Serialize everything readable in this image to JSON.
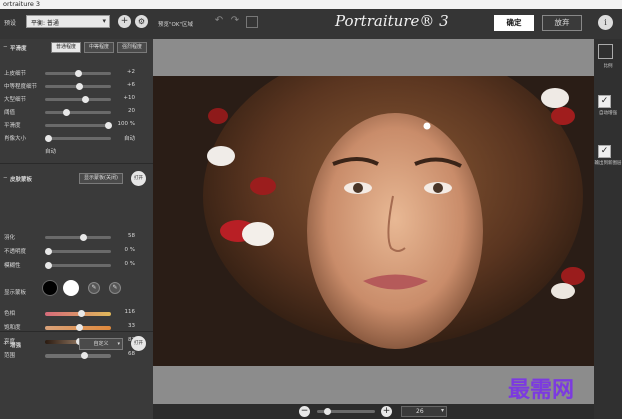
{
  "window": {
    "title": "ortraiture 3"
  },
  "topbar": {
    "preset_label": "预设",
    "preset_value": "平衡: 普通",
    "preview_label": "预览\"OK\"区域",
    "logo": "Portraiture® 3",
    "ok_label": "确定",
    "cancel_label": "放弃",
    "info_label": "i"
  },
  "smoothing": {
    "title": "平滑度",
    "tabs": [
      "普通程度",
      "中等程度",
      "强烈程度"
    ],
    "sliders": [
      {
        "label": "上皮细节",
        "value": "+2",
        "level": 0.5
      },
      {
        "label": "中等程度细节",
        "value": "+6",
        "level": 0.52
      },
      {
        "label": "大型细节",
        "value": "+10",
        "level": 0.62
      },
      {
        "label": "阈值",
        "value": "20",
        "level": 0.3
      },
      {
        "label": "平滑度",
        "value": "100 %",
        "level": 1.0
      },
      {
        "label": "肖像大小",
        "value": "自动",
        "level": 0.0
      }
    ],
    "auto_label": "自动"
  },
  "skin_mask": {
    "title": "皮肤蒙板",
    "show_mask_label": "显示蒙板(关闭)",
    "toggle_label": "打开",
    "sliders": [
      {
        "label": "羽化",
        "value": "58",
        "level": 0.58
      },
      {
        "label": "不透明度",
        "value": "0 %",
        "level": 0.0
      },
      {
        "label": "模糊性",
        "value": "0 %",
        "level": 0.0
      }
    ],
    "color_label": "显示蒙板",
    "color_sliders": [
      {
        "label": "色相",
        "value": "116",
        "level": 0.55
      },
      {
        "label": "饱和度",
        "value": "33",
        "level": 0.52
      },
      {
        "label": "亮度",
        "value": "82",
        "level": 0.52
      },
      {
        "label": "范围",
        "value": "68",
        "level": 0.6
      }
    ]
  },
  "enhance": {
    "title": "增强",
    "dropdown_value": "自定义",
    "toggle_label": "打开"
  },
  "right_panel": {
    "items": [
      {
        "label": "比例"
      },
      {
        "label": "自动增强"
      },
      {
        "label": "输出到新图层"
      }
    ]
  },
  "bottom": {
    "zoom_value": "26"
  },
  "watermark": "最需网",
  "colors": {
    "bg": "#2e2e2e",
    "panel": "#3a3a3a",
    "accent_watermark": "#7c3ae0",
    "hue_gradient_start": "#d66b7a",
    "sat_gradient_end": "#e0893c"
  }
}
